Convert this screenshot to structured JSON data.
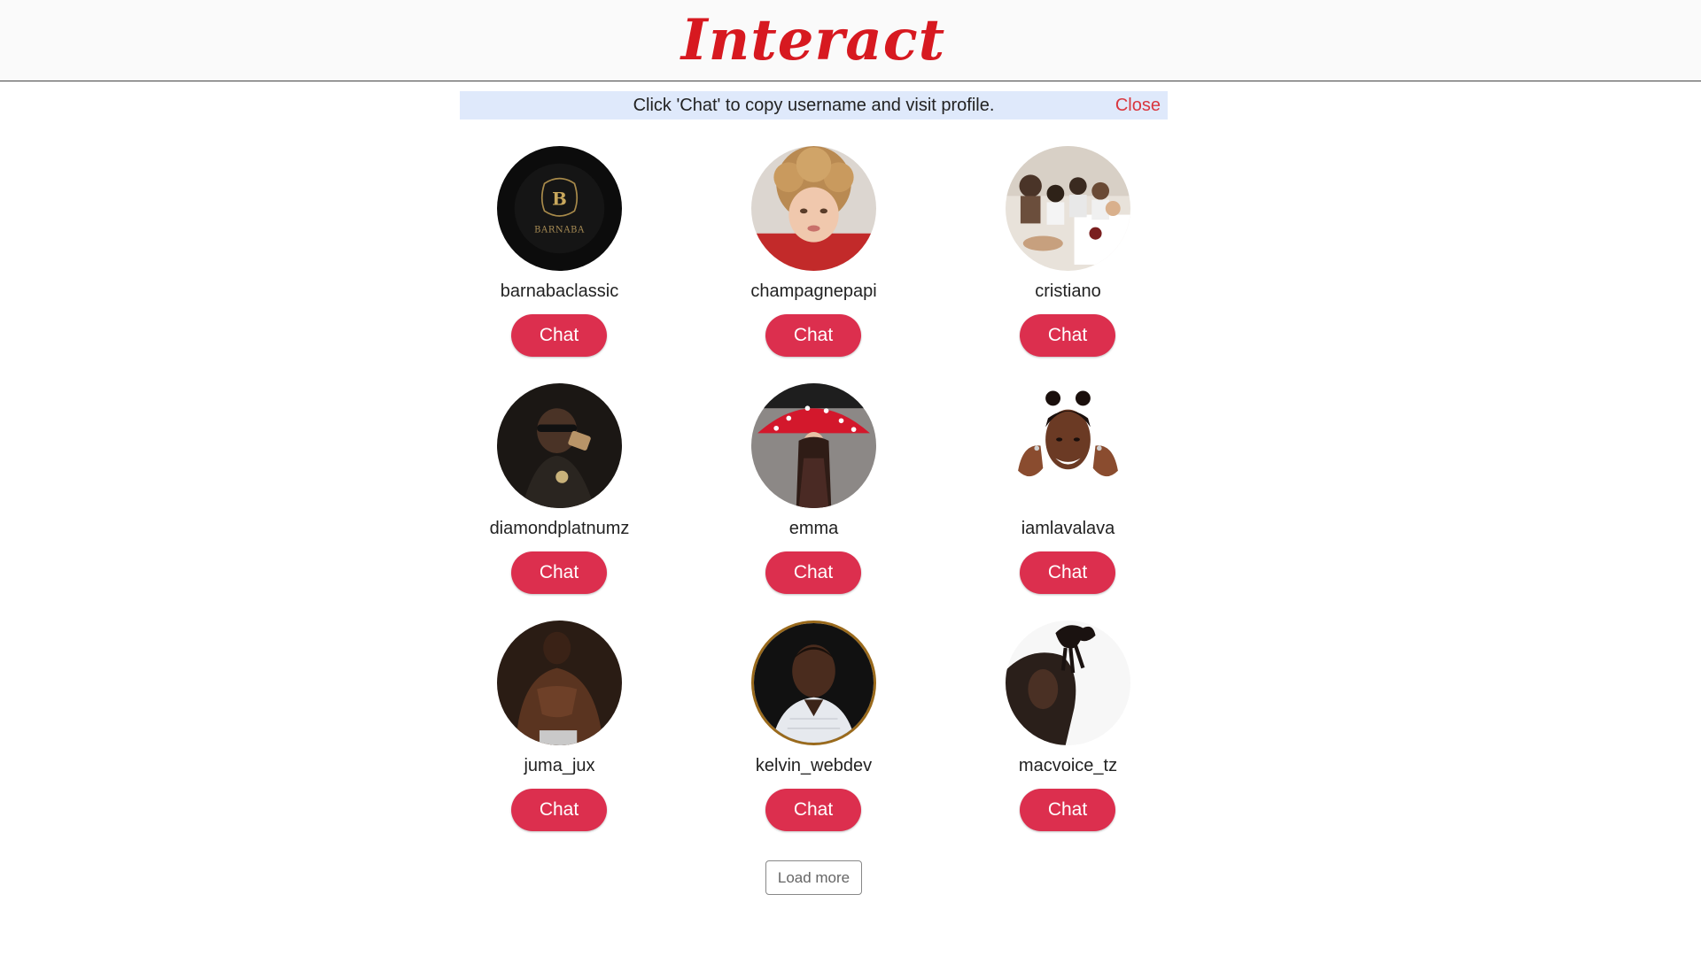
{
  "header": {
    "logo_text": "Interact"
  },
  "notice": {
    "text": "Click 'Chat' to copy username and visit profile.",
    "close_label": "Close"
  },
  "users": [
    {
      "username": "barnabaclassic",
      "chat_label": "Chat",
      "avatar_style": "dark-logo",
      "logo_letter": "B",
      "logo_text": "BARNABA"
    },
    {
      "username": "champagnepapi",
      "chat_label": "Chat",
      "avatar_style": "child-curly"
    },
    {
      "username": "cristiano",
      "chat_label": "Chat",
      "avatar_style": "family-group"
    },
    {
      "username": "diamondplatnumz",
      "chat_label": "Chat",
      "avatar_style": "dark-portrait"
    },
    {
      "username": "emma",
      "chat_label": "Chat",
      "avatar_style": "red-umbrella"
    },
    {
      "username": "iamlavalava",
      "chat_label": "Chat",
      "avatar_style": "cutout-portrait"
    },
    {
      "username": "juma_jux",
      "chat_label": "Chat",
      "avatar_style": "dark-portrait"
    },
    {
      "username": "kelvin_webdev",
      "chat_label": "Chat",
      "avatar_style": "gold-ring-portrait"
    },
    {
      "username": "macvoice_tz",
      "chat_label": "Chat",
      "avatar_style": "dreadlocks-profile"
    }
  ],
  "load_more_label": "Load more",
  "colors": {
    "brand": "#d71920",
    "chat_button": "#dc2f4e",
    "notice_bg": "#dfe9fb",
    "close_link": "#d9363e"
  }
}
